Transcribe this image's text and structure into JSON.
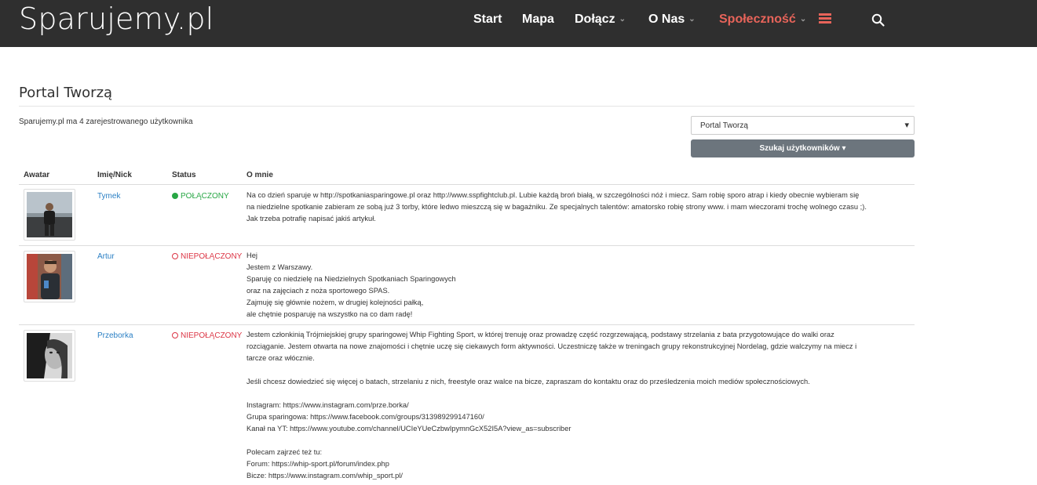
{
  "brand": "Sparujemy.pl",
  "nav": {
    "items": [
      {
        "label": "Start"
      },
      {
        "label": "Mapa"
      },
      {
        "label": "Dołącz"
      },
      {
        "label": "O Nas"
      },
      {
        "label": "Społeczność"
      }
    ],
    "caret": "⌄",
    "accent_color": "#e8645a",
    "icons": [
      "menu-icon",
      "search-icon"
    ]
  },
  "page": {
    "title": "Portal Tworzą",
    "user_count": "Sparujemy.pl ma 4 zarejestrowanego użytkownika"
  },
  "filter": {
    "select_value": "Portal Tworzą",
    "select_arrow": "▾",
    "search_button": "Szukaj użytkowników ▾"
  },
  "table": {
    "headers": [
      "Awatar",
      "Imię/Nick",
      "Status",
      "O mnie"
    ],
    "rows": [
      {
        "nick": "Tymek",
        "status": "POŁĄCZONY",
        "online": true,
        "about": "Na co dzień sparuje w http://spotkaniasparingowe.pl oraz http://www.sspfightclub.pl. Lubie każdą broń białą, w szczególności nóż i miecz. Sam robię sporo atrap i kiedy obecnie wybieram się\nna niedzielne spotkanie zabieram ze sobą już 3 torby, które ledwo mieszczą się w bagażniku. Ze specjalnych talentów: amatorsko robię strony www. i mam wieczorami trochę wolnego czasu ;).\nJak trzeba potrafię napisać jakiś artykuł."
      },
      {
        "nick": "Artur",
        "status": "NIEPOŁĄCZONY",
        "online": false,
        "about": "Hej\nJestem z Warszawy.\nSparuję co niedzielę na Niedzielnych Spotkaniach Sparingowych\noraz na zajęciach z noża sportowego SPAS.\nZajmuję się głównie nożem, w drugiej kolejności pałką,\nale chętnie posparuję na wszystko na co dam radę!"
      },
      {
        "nick": "Przeborka",
        "status": "NIEPOŁĄCZONY",
        "online": false,
        "about": "Jestem członkinią Trójmiejskiej grupy sparingowej Whip Fighting Sport, w której trenuję oraz prowadzę część rozgrzewającą, podstawy strzelania z bata przygotowujące do walki oraz\nrozciąganie. Jestem otwarta na nowe znajomości i chętnie uczę się ciekawych form aktywności. Uczestniczę także w treningach grupy rekonstrukcyjnej Nordelag, gdzie walczymy na miecz i\ntarcze oraz włócznie.\n\nJeśli chcesz dowiedzieć się więcej o batach, strzelaniu z nich, freestyle oraz walce na bicze, zapraszam do kontaktu oraz do prześledzenia moich mediów społecznościowych.\n\nInstagram: https://www.instagram.com/prze.borka/\nGrupa sparingowa: https://www.facebook.com/groups/313989299147160/\nKanał na YT: https://www.youtube.com/channel/UCIeYUeCzbwIpymnGcX52I5A?view_as=subscriber\n\nPolecam zajrzeć też tu:\nForum: https://whip-sport.pl/forum/index.php\nBicze: https://www.instagram.com/whip_sport.pl/"
      }
    ]
  }
}
